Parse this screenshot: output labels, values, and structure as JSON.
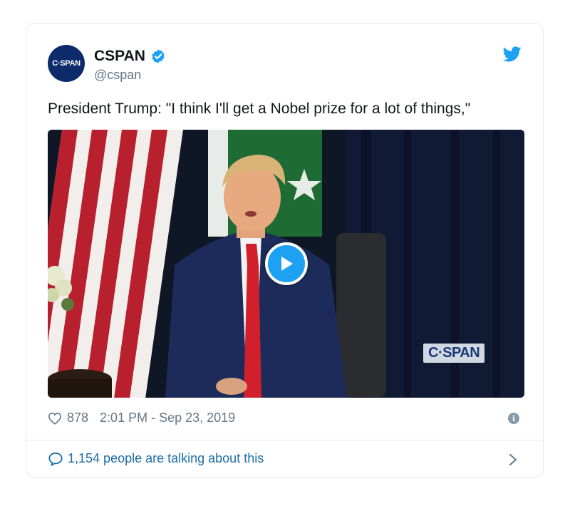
{
  "tweet": {
    "avatar_text": "C·SPAN",
    "display_name": "CSPAN",
    "handle": "@cspan",
    "text": "President Trump: \"I think I'll get a Nobel prize for a lot of things,\"",
    "video": {
      "watermark": "C·SPAN",
      "play_icon": "play-icon"
    },
    "likes": "878",
    "timestamp": "2:01 PM - Sep 23, 2019",
    "conversation": "1,154 people are talking about this"
  },
  "colors": {
    "brand_blue": "#1da1f2",
    "link_blue": "#1b6ea8",
    "muted_text": "#657786",
    "border": "#e1e8ed",
    "cspan_navy": "#0d2b6b"
  },
  "icons": [
    "verified-badge-icon",
    "twitter-bird-icon",
    "heart-icon",
    "info-icon",
    "speech-bubble-icon",
    "chevron-right-icon",
    "play-icon"
  ]
}
